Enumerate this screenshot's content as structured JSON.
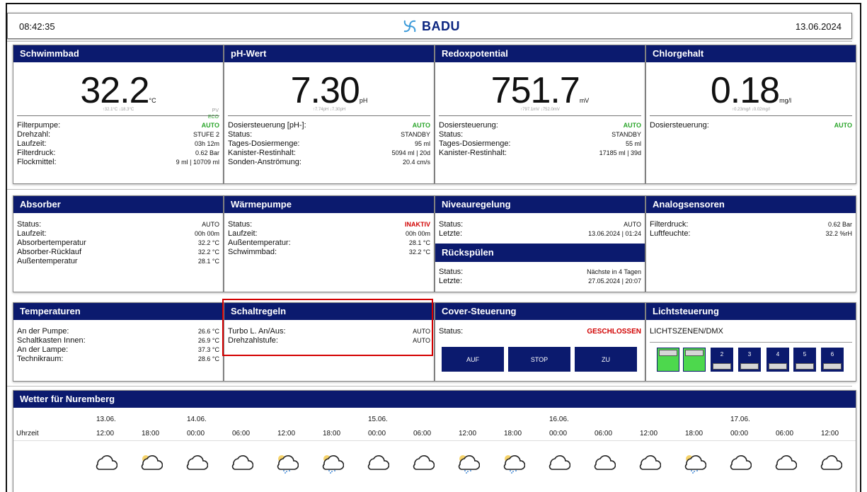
{
  "header": {
    "time": "08:42:35",
    "brand": "BADU",
    "date": "13.06.2024"
  },
  "pool": {
    "title": "Schwimmbad",
    "value": "32.2",
    "unit": "°C",
    "minmax": "↑32.1°C ↓18.3°C",
    "pv": "PV",
    "eco": "ECO",
    "rows": [
      {
        "label": "Filterpumpe:",
        "value": "AUTO"
      },
      {
        "label": "Drehzahl:",
        "value": "STUFE 2"
      },
      {
        "label": "Laufzeit:",
        "value": "03h 12m"
      },
      {
        "label": "Filterdruck:",
        "value": "0.62 Bar"
      },
      {
        "label": "Flockmittel:",
        "value": "9 ml | 10709 ml"
      }
    ]
  },
  "ph": {
    "title": "pH-Wert",
    "value": "7.30",
    "unit": "pH",
    "minmax": "↑7.74pH ↓7.30pH",
    "rows": [
      {
        "label": "Dosiersteuerung [pH-]:",
        "value": "AUTO"
      },
      {
        "label": "Status:",
        "value": "STANDBY"
      },
      {
        "label": "Tages-Dosiermenge:",
        "value": "95 ml"
      },
      {
        "label": "Kanister-Restinhalt:",
        "value": "5094 ml | 20d"
      },
      {
        "label": "Sonden-Anströmung:",
        "value": "20.4 cm/s"
      }
    ]
  },
  "redox": {
    "title": "Redoxpotential",
    "value": "751.7",
    "unit": "mV",
    "minmax": "↑797.1mV ↓752.0mV",
    "rows": [
      {
        "label": "Dosiersteuerung:",
        "value": "AUTO"
      },
      {
        "label": "Status:",
        "value": "STANDBY"
      },
      {
        "label": "Tages-Dosiermenge:",
        "value": "55 ml"
      },
      {
        "label": "Kanister-Restinhalt:",
        "value": "17185 ml | 39d"
      }
    ]
  },
  "chlor": {
    "title": "Chlorgehalt",
    "value": "0.18",
    "unit": "mg/l",
    "minmax": "↑0.23mg/l ↓0.02mg/l",
    "rows": [
      {
        "label": "Dosiersteuerung:",
        "value": "AUTO"
      }
    ]
  },
  "absorber": {
    "title": "Absorber",
    "rows": [
      {
        "label": "Status:",
        "value": "AUTO"
      },
      {
        "label": "Laufzeit:",
        "value": "00h 00m"
      },
      {
        "label": "Absorbertemperatur",
        "value": "32.2 °C"
      },
      {
        "label": "Absorber-Rücklauf",
        "value": "32.2 °C"
      },
      {
        "label": "Außentemperatur",
        "value": "28.1 °C"
      }
    ]
  },
  "heatpump": {
    "title": "Wärmepumpe",
    "rows": [
      {
        "label": "Status:",
        "value": "INAKTIV"
      },
      {
        "label": "Laufzeit:",
        "value": "00h 00m"
      },
      {
        "label": "Außentemperatur:",
        "value": "28.1 °C"
      },
      {
        "label": "Schwimmbad:",
        "value": "32.2 °C"
      }
    ]
  },
  "level": {
    "title": "Niveauregelung",
    "rows": [
      {
        "label": "Status:",
        "value": "AUTO"
      },
      {
        "label": "Letzte:",
        "value": "13.06.2024 | 01:24"
      }
    ],
    "backwash_title": "Rückspülen",
    "backwash_rows": [
      {
        "label": "Status:",
        "value": "Nächste in 4 Tagen"
      },
      {
        "label": "Letzte:",
        "value": "27.05.2024 | 20:07"
      }
    ]
  },
  "analog": {
    "title": "Analogsensoren",
    "rows": [
      {
        "label": "Filterdruck:",
        "value": "0.62 Bar"
      },
      {
        "label": "Luftfeuchte:",
        "value": "32.2 %rH"
      }
    ]
  },
  "temps": {
    "title": "Temperaturen",
    "rows": [
      {
        "label": "An der Pumpe:",
        "value": "26.6 °C"
      },
      {
        "label": "Schaltkasten Innen:",
        "value": "26.9 °C"
      },
      {
        "label": "An der Lampe:",
        "value": "37.3 °C"
      },
      {
        "label": "Technikraum:",
        "value": "28.6 °C"
      }
    ]
  },
  "rules": {
    "title": "Schaltregeln",
    "rows": [
      {
        "label": "Turbo L. An/Aus:",
        "value": "AUTO"
      },
      {
        "label": "Drehzahlstufe:",
        "value": "AUTO"
      }
    ]
  },
  "cover": {
    "title": "Cover-Steuerung",
    "status_label": "Status:",
    "status_value": "GESCHLOSSEN",
    "buttons": [
      "AUF",
      "STOP",
      "ZU"
    ]
  },
  "light": {
    "title": "Lichtsteuerung",
    "subtitle": "LICHTSZENEN/DMX",
    "scenes": [
      "",
      "",
      "2",
      "3",
      "4",
      "5",
      "6"
    ]
  },
  "weather": {
    "title": "Wetter für Nuremberg",
    "time_label": "Uhrzeit",
    "dates": [
      "13.06.",
      "14.06.",
      "15.06.",
      "16.06.",
      "17.06."
    ],
    "times": [
      "12:00",
      "18:00",
      "00:00",
      "06:00",
      "12:00",
      "18:00",
      "00:00",
      "06:00",
      "12:00",
      "18:00",
      "00:00",
      "06:00",
      "12:00",
      "18:00",
      "00:00",
      "06:00",
      "12:00"
    ],
    "icons": [
      "cloud-icon",
      "partly-sunny-icon",
      "cloud-icon",
      "cloud-icon",
      "rain-sun-icon",
      "rain-sun-icon",
      "cloud-icon",
      "cloud-icon",
      "rain-sun-icon",
      "rain-sun-icon",
      "cloud-icon",
      "cloud-icon",
      "cloud-icon",
      "rain-sun-icon",
      "cloud-icon",
      "cloud-icon",
      "cloud-icon"
    ]
  }
}
